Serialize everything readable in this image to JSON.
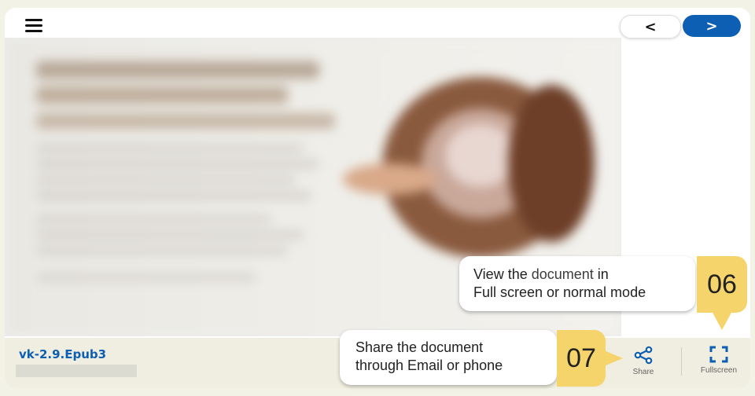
{
  "nav": {
    "prev_label": "<",
    "next_label": ">",
    "menu_icon": "hamburger-menu-icon"
  },
  "document": {
    "title": "vk-2.9.Epub3"
  },
  "toolbar": {
    "share_label": "Share",
    "fullscreen_label": "Fullscreen",
    "share_icon": "share-icon",
    "fullscreen_icon": "fullscreen-icon"
  },
  "callouts": {
    "fullscreen": {
      "line1_a": "View the ",
      "line1_b": "document",
      "line1_c": " in",
      "line2": "Full screen or normal mode",
      "badge": "06"
    },
    "share": {
      "line1": "Share the document",
      "line2": "through Email or phone",
      "badge": "07"
    }
  },
  "colors": {
    "accent": "#0d5fb3",
    "callout_badge": "#f5d46b",
    "footer_bg": "#efeee0"
  }
}
